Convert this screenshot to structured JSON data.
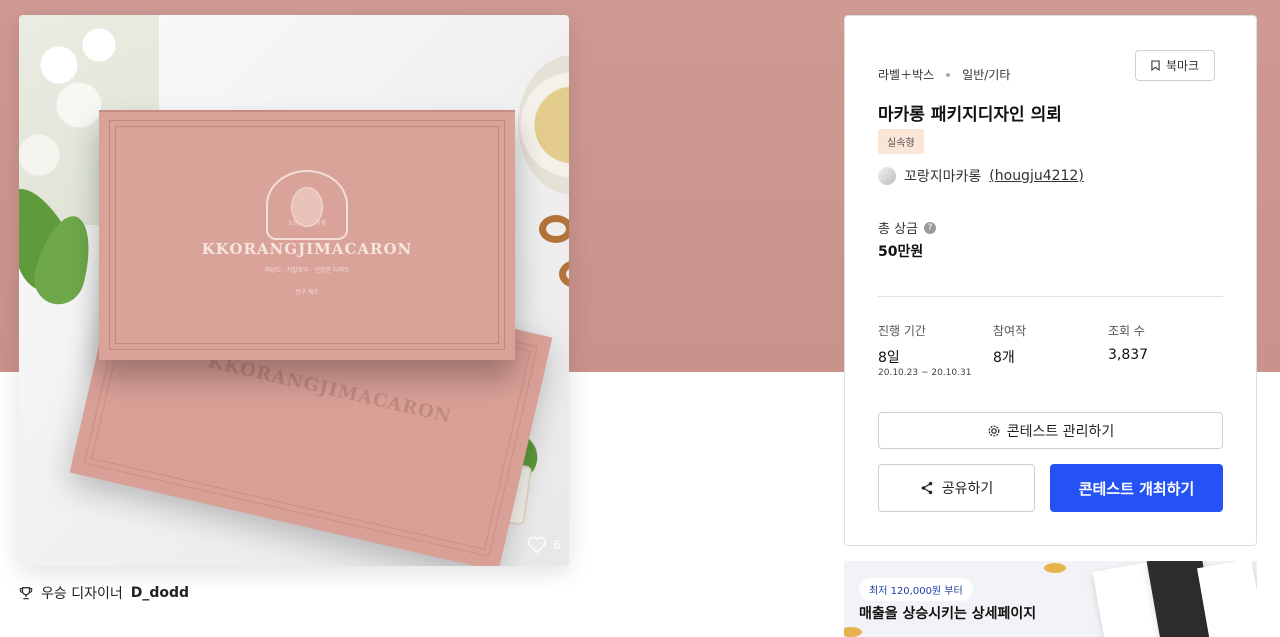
{
  "image": {
    "brand_text": "KKORANGJIMACARON",
    "brand_small_top": "꼬랑지 · 마카롱",
    "brand_sub": "저당도 · 저칼로리 · 건강한 디저트",
    "brand_sub2": "선구 제조",
    "like_count": "6"
  },
  "designer": {
    "label": "우승 디자이너",
    "name": "D_dodd"
  },
  "panel": {
    "category": "라벨＋박스",
    "subcategory": "일반/기타",
    "bookmark_label": "북마크",
    "title": "마카롱 패키지디자인 의뢰",
    "tag": "실속형",
    "host_name": "꼬랑지마카롱",
    "host_id": "hougju4212",
    "prize_label": "총 상금",
    "prize_value": "50만원",
    "stats": {
      "period_label": "진행 기간",
      "period_value": "8일",
      "period_range": "20.10.23  ~  20.10.31",
      "entries_label": "참여작",
      "entries_value": "8개",
      "views_label": "조회 수",
      "views_value": "3,837"
    },
    "manage_button": "콘테스트 관리하기",
    "share_button": "공유하기",
    "host_button": "콘테스트 개최하기"
  },
  "banner": {
    "pill": "최저 120,000원 부터",
    "text": "매출을 상승시키는 상세페이지"
  },
  "colors": {
    "hero_bg": "#cf9a93",
    "primary": "#2552f5",
    "tag_bg": "#fbe5d6"
  }
}
